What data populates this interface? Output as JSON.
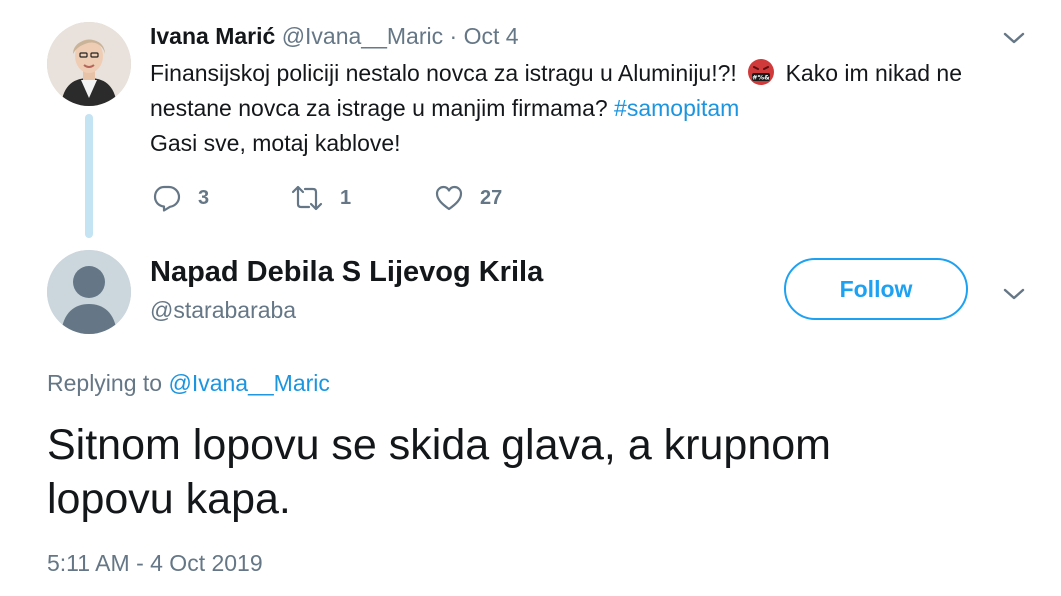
{
  "parent_tweet": {
    "author_name": "Ivana Marić",
    "handle": "@Ivana__Maric",
    "separator": "·",
    "date": "Oct 4",
    "line1_before_emoji": "Finansijskoj policiji nestalo novca za istragu u Aluminiju!?!",
    "emoji": "censored-swearing-face-emoji",
    "line1_after_emoji": "Kako im nikad ne",
    "line2_text": "nestane novca za istrage u manjim firmama?",
    "hashtag": "#samopitam",
    "line3": "Gasi sve, motaj kablove!",
    "reply_count": "3",
    "retweet_count": "1",
    "like_count": "27"
  },
  "main_tweet": {
    "author_name": "Napad Debila S Lijevog Krila",
    "handle": "@starabaraba",
    "follow_label": "Follow",
    "replying_prefix": "Replying to",
    "replying_mention": "@Ivana__Maric",
    "text_line1": "Sitnom lopovu se skida glava, a krupnom",
    "text_line2": "lopovu kapa.",
    "timestamp": "5:11 AM - 4 Oct 2019"
  },
  "icons": {
    "reply": "reply-icon",
    "retweet": "retweet-icon",
    "like": "heart-icon",
    "caret": "chevron-down-icon"
  },
  "colors": {
    "accent": "#1da1f2",
    "link": "#1b95e0",
    "secondary_text": "#657786",
    "thread_line": "#c4e3f3"
  }
}
